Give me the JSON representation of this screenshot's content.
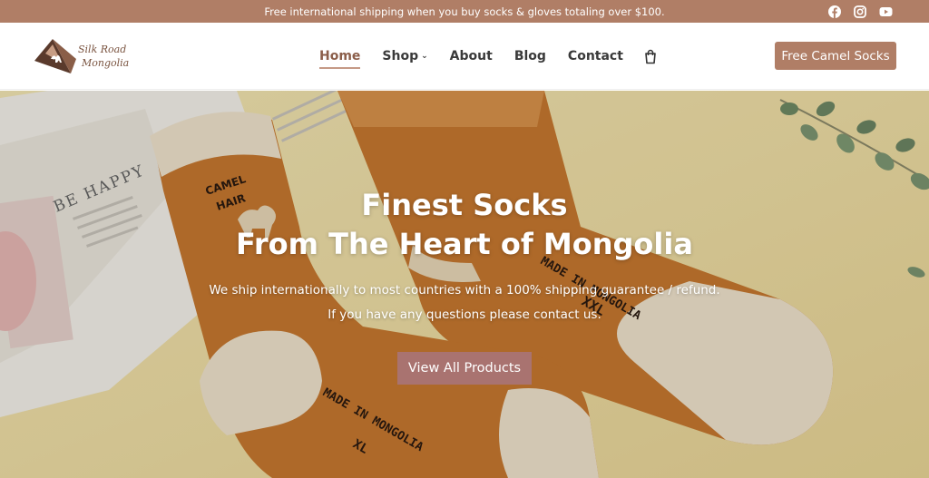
{
  "topbar": {
    "announcement": "Free international shipping when you buy socks & gloves totaling over $100.",
    "social_icons": [
      "facebook-icon",
      "instagram-icon",
      "youtube-icon"
    ]
  },
  "header": {
    "logo": {
      "line1": "Silk Road",
      "line2": "Mongolia"
    },
    "nav": {
      "home": "Home",
      "shop": "Shop",
      "about": "About",
      "blog": "Blog",
      "contact": "Contact"
    },
    "cart_icon": "cart-icon",
    "cta_label": "Free Camel Socks"
  },
  "hero": {
    "title_line1": "Finest Socks",
    "title_line2": "From The Heart of Mongolia",
    "subtitle_line1": "We ship internationally to most countries with a 100% shipping guarantee / refund.",
    "subtitle_line2": "If you have any questions please contact us.",
    "button_label": "View All Products",
    "photo_text": {
      "magazine": "BE HAPPY",
      "label1": "CAMEL",
      "label2": "HAIR",
      "made_in_right": "MADE IN MONGOLIA",
      "size_right": "XXL",
      "made_in_left": "MADE IN MONGOLIA",
      "size_left": "XL"
    }
  },
  "colors": {
    "brand": "#b07e66",
    "hero_button": "#a97370",
    "sock": "#c77b34",
    "sock_cream": "#efe3cc",
    "background": "#f1e3ab"
  }
}
